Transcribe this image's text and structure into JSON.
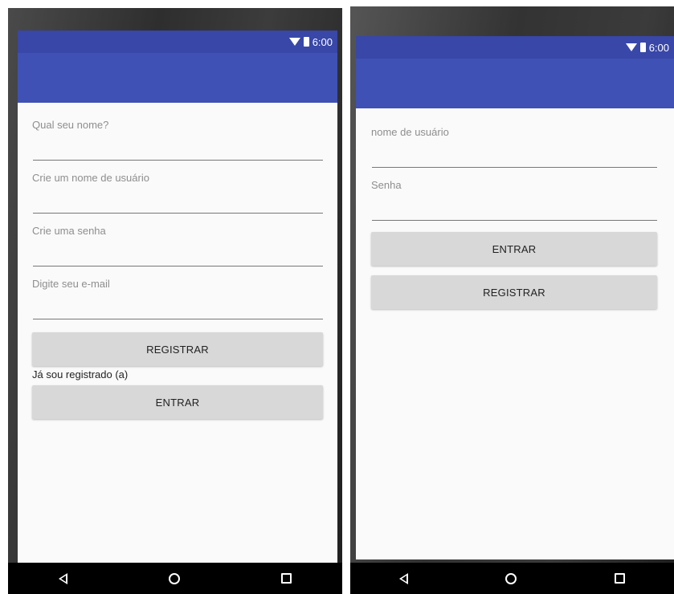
{
  "register_screen": {
    "status_time": "6:00",
    "fields": [
      {
        "placeholder": "Qual seu nome?",
        "value": ""
      },
      {
        "placeholder": "Crie um nome de usuário",
        "value": ""
      },
      {
        "placeholder": "Crie uma senha",
        "value": ""
      },
      {
        "placeholder": "Digite seu e-mail",
        "value": ""
      }
    ],
    "register_button": "REGISTRAR",
    "already_registered_text": "Já sou registrado (a)",
    "login_button": "ENTRAR"
  },
  "login_screen": {
    "status_time": "6:00",
    "fields": [
      {
        "placeholder": "nome de usuário",
        "value": ""
      },
      {
        "placeholder": "Senha",
        "value": ""
      }
    ],
    "login_button": "ENTRAR",
    "register_button": "REGISTRAR"
  },
  "navbar": {
    "icons": [
      "back-icon",
      "home-icon",
      "recent-apps-icon"
    ]
  },
  "colors": {
    "appbar": "#3f51b5",
    "statusbar": "#3847a8",
    "button": "#d8d8d8",
    "screen_bg": "#fafafa"
  }
}
